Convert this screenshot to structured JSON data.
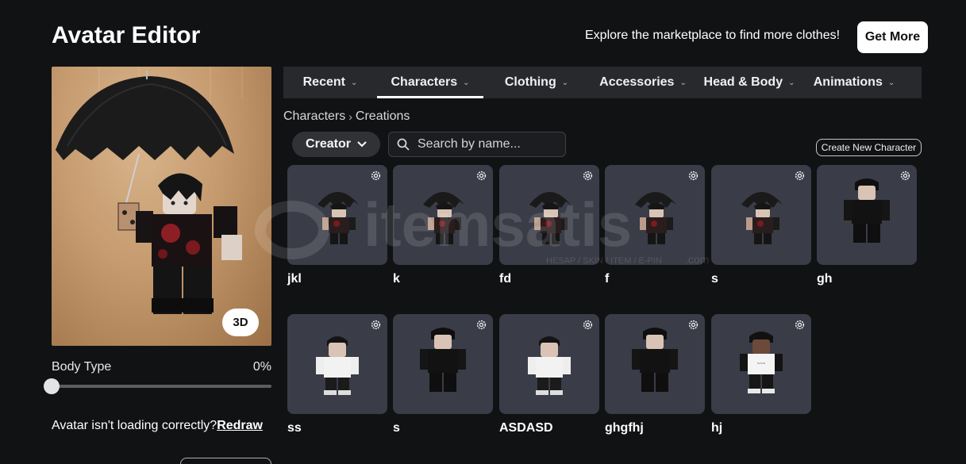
{
  "header": {
    "title": "Avatar Editor",
    "promo_text": "Explore the marketplace to find more clothes!",
    "get_more_label": "Get More"
  },
  "preview": {
    "view_toggle_label": "3D"
  },
  "body_type": {
    "label": "Body Type",
    "value": "0%",
    "level": 0
  },
  "loading_help": {
    "text": "Avatar isn't loading correctly?",
    "link_label": "Redraw"
  },
  "tabs": [
    {
      "label": "Recent",
      "active": false
    },
    {
      "label": "Characters",
      "active": true
    },
    {
      "label": "Clothing",
      "active": false
    },
    {
      "label": "Accessories",
      "active": false
    },
    {
      "label": "Head & Body",
      "active": false
    },
    {
      "label": "Animations",
      "active": false
    }
  ],
  "breadcrumb": {
    "parent": "Characters",
    "current": "Creations"
  },
  "filters": {
    "creator_label": "Creator",
    "search_placeholder": "Search by name...",
    "create_new_label": "Create New Character"
  },
  "characters": [
    {
      "name": "jkl",
      "icon": "umbrella-avatar-icon"
    },
    {
      "name": "k",
      "icon": "umbrella-avatar-icon"
    },
    {
      "name": "fd",
      "icon": "umbrella-avatar-icon"
    },
    {
      "name": "f",
      "icon": "umbrella-avatar-icon"
    },
    {
      "name": "s",
      "icon": "umbrella-avatar-icon"
    },
    {
      "name": "gh",
      "icon": "black-outfit-avatar-icon"
    },
    {
      "name": "ss",
      "icon": "white-shirt-avatar-icon"
    },
    {
      "name": "s",
      "icon": "black-outfit-avatar-icon"
    },
    {
      "name": "ASDASD",
      "icon": "white-shirt-avatar-icon"
    },
    {
      "name": "ghgfhj",
      "icon": "black-outfit-avatar-icon"
    },
    {
      "name": "hj",
      "icon": "graphic-tee-avatar-icon"
    }
  ],
  "watermark": {
    "brand": "itemsatis",
    "tagline": "HESAP / SKIN / ITEM / E-PIN",
    "suffix": ".com"
  },
  "colors": {
    "background": "#111214",
    "tab_bar": "#27292d",
    "card": "#3a3c47",
    "preview_bg": "#c59a6e"
  }
}
